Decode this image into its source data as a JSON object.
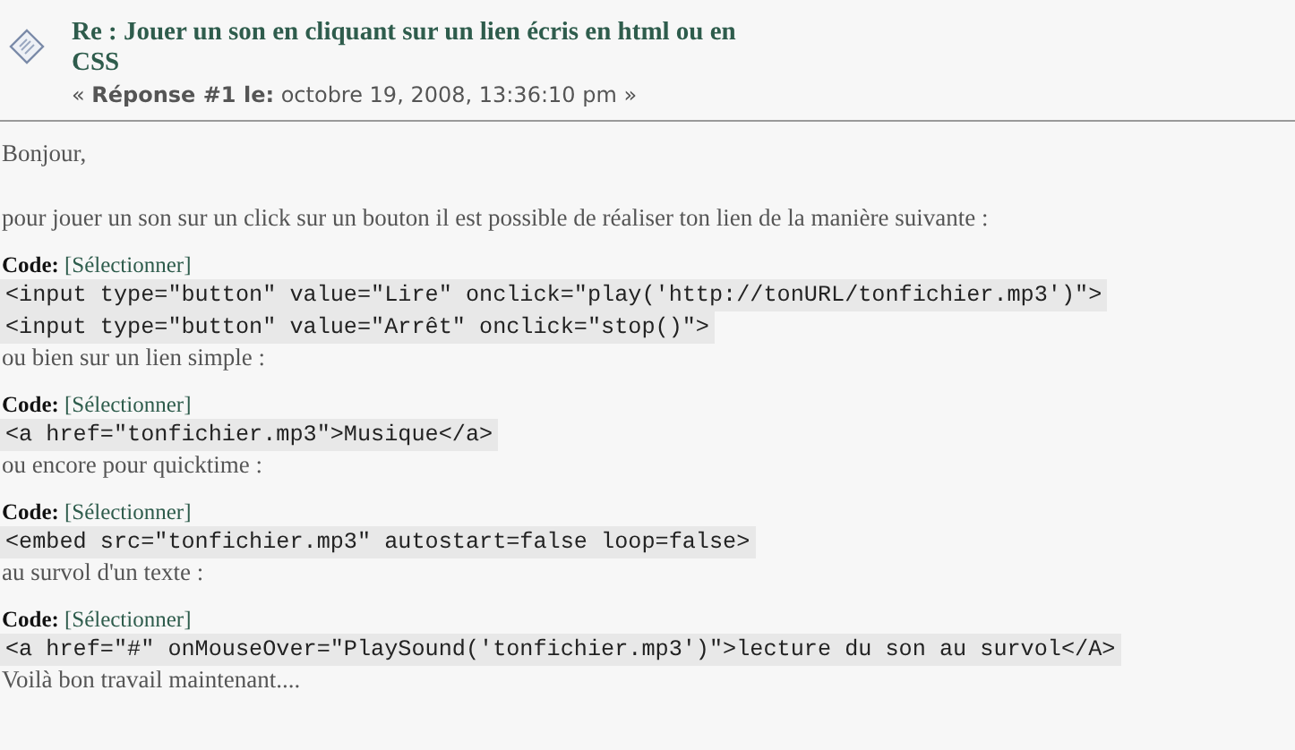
{
  "post": {
    "title": "Re : Jouer un son en cliquant sur un lien écris en html ou en CSS",
    "meta": "« **Réponse #1 le:** octobre 19, 2008, 13:36:10 pm »"
  },
  "body": [
    {
      "kind": "text",
      "text": "Bonjour,"
    },
    {
      "kind": "text",
      "text": "pour jouer un son sur un click sur un bouton il est possible de réaliser ton lien de la manière suivante  :"
    },
    {
      "kind": "code",
      "label": "Code:",
      "select": "[Sélectionner]",
      "lines": [
        "<input type=\"button\" value=\"Lire\" onclick=\"play('http://tonURL/tonfichier.mp3')\">",
        "<input type=\"button\" value=\"Arrêt\" onclick=\"stop()\">"
      ]
    },
    {
      "kind": "text",
      "text": "ou bien sur un lien simple :"
    },
    {
      "kind": "code",
      "label": "Code:",
      "select": "[Sélectionner]",
      "lines": [
        "<a href=\"tonfichier.mp3\">Musique</a>"
      ]
    },
    {
      "kind": "text",
      "text": "ou encore pour quicktime :"
    },
    {
      "kind": "code",
      "label": "Code:",
      "select": "[Sélectionner]",
      "lines": [
        "<embed src=\"tonfichier.mp3\" autostart=false loop=false>"
      ]
    },
    {
      "kind": "text",
      "text": "au survol d'un texte :"
    },
    {
      "kind": "code",
      "label": "Code:",
      "select": "[Sélectionner]",
      "lines": [
        "<a href=\"#\" onMouseOver=\"PlaySound('tonfichier.mp3')\">lecture du son au survol</A>"
      ]
    },
    {
      "kind": "text",
      "text": "Voilà bon travail maintenant...."
    }
  ]
}
